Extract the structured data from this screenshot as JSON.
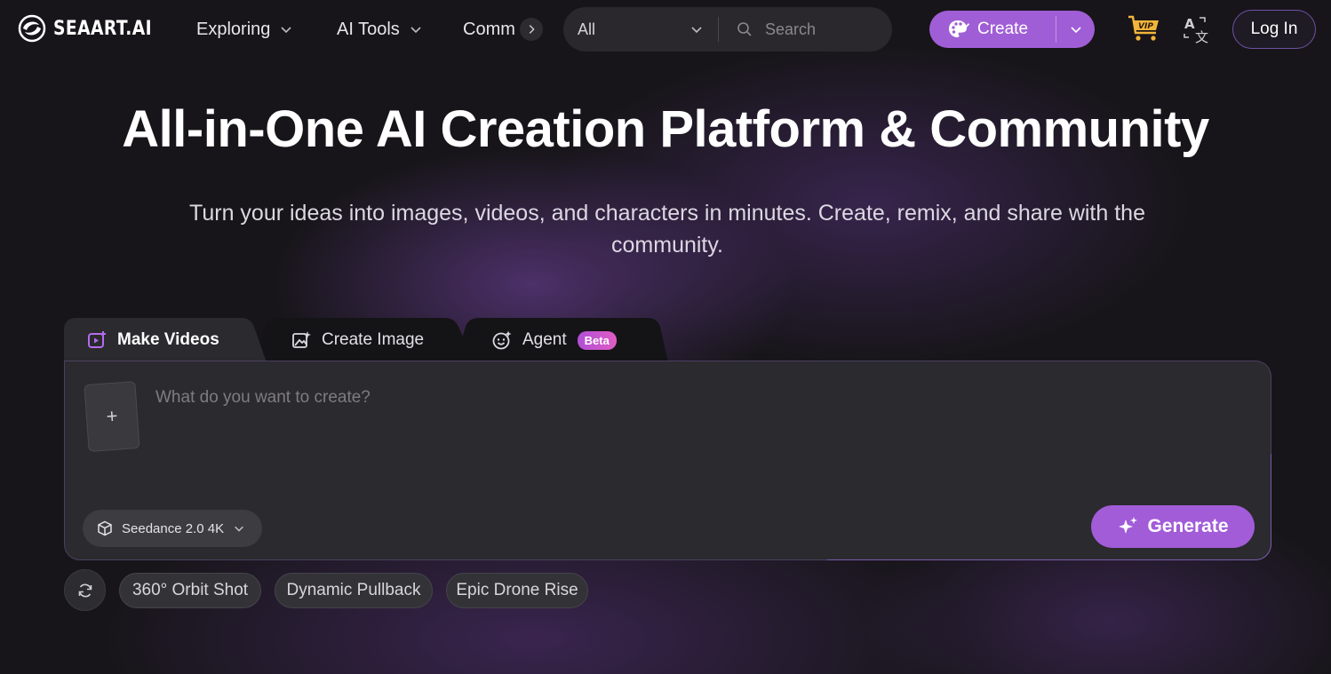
{
  "header": {
    "logo_text": "SEAART.AI",
    "nav": [
      {
        "label": "Exploring"
      },
      {
        "label": "AI Tools"
      },
      {
        "label": "Comm"
      }
    ],
    "search": {
      "filter_value": "All",
      "placeholder": "Search"
    },
    "create_label": "Create",
    "login_label": "Log In",
    "vip_badge": "VIP",
    "accent_color": "#a05ed6"
  },
  "hero": {
    "title": "All-in-One AI Creation Platform & Community",
    "subtitle": "Turn your ideas into images, videos, and characters in minutes. Create, remix, and share with the community."
  },
  "tabs": [
    {
      "label": "Make Videos",
      "icon": "video-plus-icon",
      "active": true
    },
    {
      "label": "Create Image",
      "icon": "image-sparkle-icon",
      "active": false
    },
    {
      "label": "Agent",
      "icon": "smile-sparkle-icon",
      "badge": "Beta",
      "active": false
    }
  ],
  "prompt": {
    "placeholder": "What do you want to create?",
    "upload_symbol": "+",
    "model_label": "Seedance 2.0 4K",
    "generate_label": "Generate"
  },
  "suggestions": [
    {
      "label": "360° Orbit Shot"
    },
    {
      "label": "Dynamic Pullback"
    },
    {
      "label": "Epic Drone Rise"
    }
  ]
}
